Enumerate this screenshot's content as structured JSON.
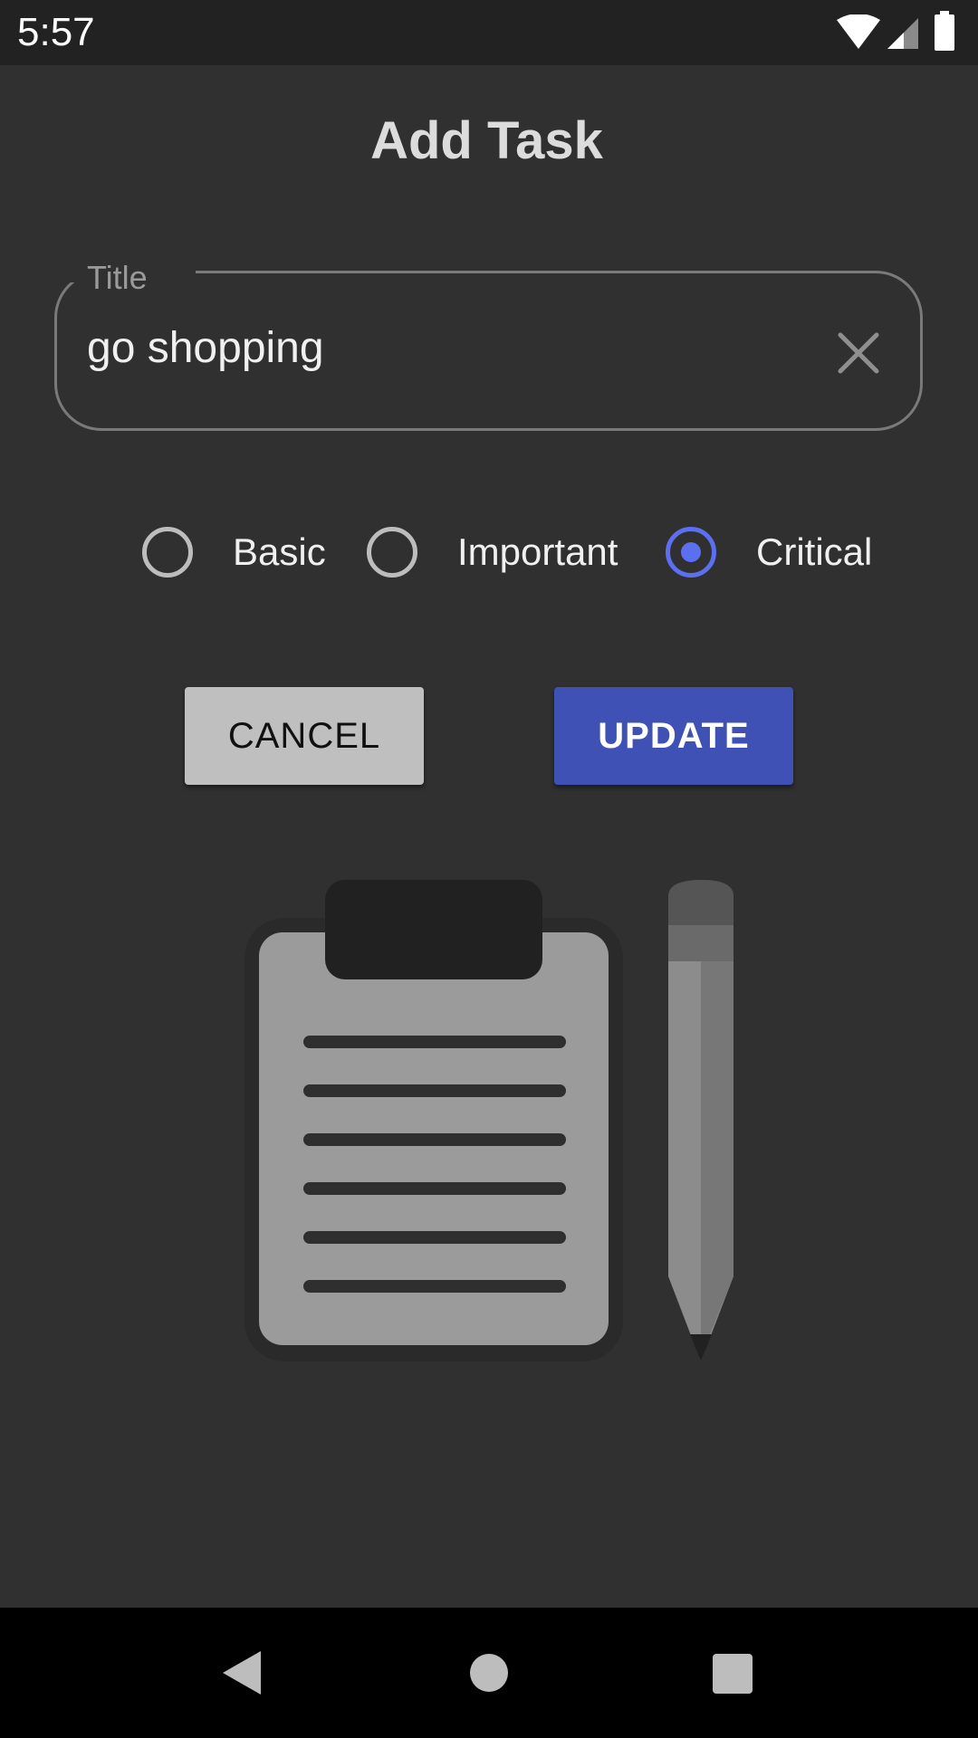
{
  "status_bar": {
    "time": "5:57",
    "icons": [
      "wifi-icon",
      "cell-signal-icon",
      "battery-icon"
    ]
  },
  "page": {
    "title": "Add Task"
  },
  "title_field": {
    "label": "Title",
    "value": "go shopping",
    "clear_icon": "close-icon"
  },
  "priority": {
    "options": [
      {
        "label": "Basic",
        "checked": false
      },
      {
        "label": "Important",
        "checked": false
      },
      {
        "label": "Critical",
        "checked": true
      }
    ],
    "accent_color": "#5c6ff0"
  },
  "actions": {
    "cancel_label": "CANCEL",
    "update_label": "UPDATE",
    "update_color": "#3f51b5"
  },
  "illustration": {
    "icons": [
      "clipboard-icon",
      "pencil-icon"
    ]
  },
  "nav_bar": {
    "icons": [
      "back-icon",
      "home-icon",
      "recents-icon"
    ]
  }
}
